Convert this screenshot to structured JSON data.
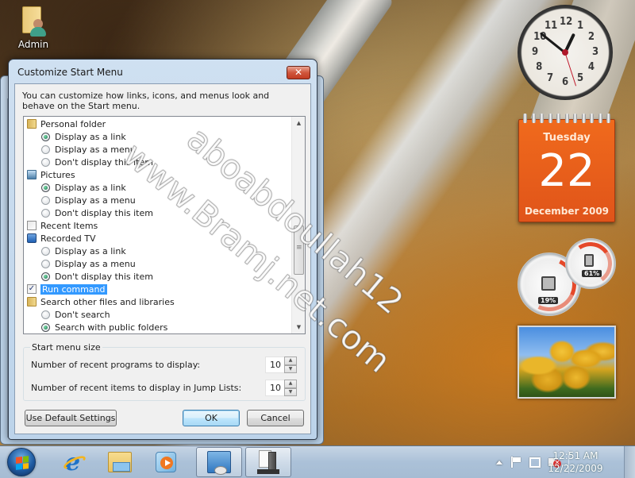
{
  "desktop": {
    "icons": [
      {
        "label": "Admin",
        "icon": "user-folder-icon"
      }
    ],
    "watermark": [
      "aboabdoullah12",
      "www.Bramj.net.com"
    ]
  },
  "dialog": {
    "title": "Customize Start Menu",
    "close_label": "✕",
    "description": "You can customize how links, icons, and menus look and behave on the Start menu.",
    "list": {
      "items": [
        {
          "type": "category",
          "label": "Personal folder",
          "icon": "personal-folder-icon"
        },
        {
          "type": "radio",
          "label": "Display as a link",
          "checked": true
        },
        {
          "type": "radio",
          "label": "Display as a menu",
          "checked": false
        },
        {
          "type": "radio",
          "label": "Don't display this item",
          "checked": false
        },
        {
          "type": "category",
          "label": "Pictures",
          "icon": "pictures-icon"
        },
        {
          "type": "radio",
          "label": "Display as a link",
          "checked": true
        },
        {
          "type": "radio",
          "label": "Display as a menu",
          "checked": false
        },
        {
          "type": "radio",
          "label": "Don't display this item",
          "checked": false
        },
        {
          "type": "checkbox",
          "label": "Recent Items",
          "checked": false
        },
        {
          "type": "category",
          "label": "Recorded TV",
          "icon": "tv-icon"
        },
        {
          "type": "radio",
          "label": "Display as a link",
          "checked": false
        },
        {
          "type": "radio",
          "label": "Display as a menu",
          "checked": false
        },
        {
          "type": "radio",
          "label": "Don't display this item",
          "checked": true
        },
        {
          "type": "checkbox",
          "label": "Run command",
          "checked": true,
          "selected": true
        },
        {
          "type": "category",
          "label": "Search other files and libraries",
          "icon": "search-libraries-icon"
        },
        {
          "type": "radio",
          "label": "Don't search",
          "checked": false
        },
        {
          "type": "radio",
          "label": "Search with public folders",
          "checked": true
        }
      ],
      "scroll_position": 0.55
    },
    "start_menu_size": {
      "group_label": "Start menu size",
      "recent_programs_label": "Number of recent programs to display:",
      "recent_programs_value": "10",
      "jump_list_label": "Number of recent items to display in Jump Lists:",
      "jump_list_value": "10"
    },
    "buttons": {
      "default_settings": "Use Default Settings",
      "ok": "OK",
      "cancel": "Cancel"
    }
  },
  "gadgets": {
    "clock": {
      "numbers": [
        "12",
        "1",
        "2",
        "3",
        "4",
        "5",
        "6",
        "7",
        "8",
        "9",
        "10",
        "11"
      ],
      "hour": 0,
      "minute": 51,
      "second": 27
    },
    "calendar": {
      "day_name": "Tuesday",
      "date": "22",
      "month_year": "December 2009"
    },
    "meter": {
      "cpu_label": "19%",
      "memory_label": "61%",
      "cpu": 0.19,
      "memory": 0.61
    },
    "slideshow": {
      "subject": "yellow tulips"
    }
  },
  "taskbar": {
    "pinned": [
      {
        "name": "internet-explorer",
        "active": false
      },
      {
        "name": "windows-explorer",
        "active": false
      },
      {
        "name": "windows-media-player",
        "active": false
      },
      {
        "name": "control-panel",
        "active": true
      },
      {
        "name": "server-manager",
        "active": true
      }
    ],
    "tray": {
      "time": "12:51 AM",
      "date": "12/22/2009"
    }
  }
}
